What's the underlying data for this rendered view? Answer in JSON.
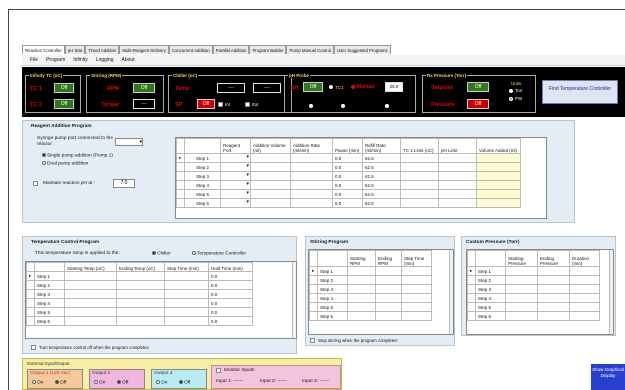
{
  "tabs": [
    "Reaction Controller",
    "pH Stat",
    "Timed Addition",
    "Multi-Reagent Delivery",
    "Concurrent Addition",
    "Parallel Addition",
    "Program Builder",
    "Pump Manual Control",
    "User Suggested Programs"
  ],
  "menu": [
    "File",
    "Program",
    "Infinity",
    "Logging",
    "About"
  ],
  "infinity_tc": {
    "title": "Infinity TC  (oC)",
    "tc1_label": "TC 1",
    "tc2_label": "TC 2",
    "tc1_state": "Off",
    "tc2_state": "Off"
  },
  "stirring": {
    "title": "Stirring (RPM)",
    "rpm_label": "RPM",
    "torque_label": "Torque",
    "rpm_state": "Off",
    "torque_value": "----"
  },
  "chiller": {
    "title": "Chiller (oC)",
    "temp_label": "Temp",
    "sp_label": "SP",
    "temp_value1": "----",
    "temp_value2": "----",
    "sp_state": "Off",
    "int_label": "Int",
    "ext_label": "Ext"
  },
  "ph_probe": {
    "title": "pH Probe",
    "ph_label": "pH",
    "ph_state": "Off",
    "tc1_label": "TC1",
    "manual_label": "Manual",
    "manual_value": "25.0"
  },
  "rx_pressure": {
    "title": "Rx Pressure (Torr)",
    "setpoint_label": "Setpoint",
    "pressure_label": "Pressure",
    "setpoint_state": "Off",
    "pressure_state": "Off",
    "units_label": "Units",
    "torr_label": "Torr",
    "psi_label": "PSI"
  },
  "find_temp_btn": "Find Temperature Controller",
  "reagent": {
    "title": "Reagent Addition Program",
    "syringe_label": "Syringe pump port connected to the reactor :",
    "single_pump": "Single pump addition (Pump 1)",
    "dual_pump": "Dual pump addition",
    "maintain_ph": "Maintain reaction pH at :",
    "ph_value": "7.0",
    "headers": [
      "Reagent Port",
      "Addition Volume (ml)",
      "Addition Rate (ml/min)",
      "Pause (min)",
      "Refill Rate (ml/min)",
      "TC 1 Limit (oC)",
      "pH Limit",
      "Volume Added (ml)"
    ],
    "rows": [
      {
        "step": "Step 1",
        "pause": "0.0",
        "refill": "62.5"
      },
      {
        "step": "Step 2",
        "pause": "0.0",
        "refill": "62.5"
      },
      {
        "step": "Step 3",
        "pause": "0.0",
        "refill": "62.5"
      },
      {
        "step": "Step 4",
        "pause": "0.0",
        "refill": "62.5"
      },
      {
        "step": "Step 5",
        "pause": "0.0",
        "refill": "62.5"
      },
      {
        "step": "Step 6",
        "pause": "0.0",
        "refill": "62.5"
      }
    ]
  },
  "temp_program": {
    "title": "Temperature Control Program",
    "applied_label": "This temperature ramp is applied to the:",
    "chiller_opt": "Chiller",
    "tc_opt": "Temperature Controller",
    "headers": [
      "Starting Temp (oC)",
      "Ending Temp (oC)",
      "Step Time (min)",
      "Hold Time (min)"
    ],
    "rows": [
      {
        "step": "Step 1",
        "hold": "0.0"
      },
      {
        "step": "Step 2",
        "hold": "0.0"
      },
      {
        "step": "Step 3",
        "hold": "0.0"
      },
      {
        "step": "Step 4",
        "hold": "0.0"
      },
      {
        "step": "Step 5",
        "hold": "0.0"
      },
      {
        "step": "Step 6",
        "hold": "0.0"
      }
    ],
    "turn_off": "Turn temperature control off when the program completes"
  },
  "stirring_program": {
    "title": "Stirring Program",
    "headers": [
      "Starting RPM",
      "Ending RPM",
      "Step Time (min)"
    ],
    "rows": [
      "Step 1",
      "Step 2",
      "Step 3",
      "Step 4",
      "Step 5",
      "Step 6"
    ],
    "stop": "Stop stirring when the program completes"
  },
  "pressure_program": {
    "title": "Custom Pressure (Torr)",
    "headers": [
      "Starting Pressure",
      "Ending Pressure",
      "Duration (min)"
    ],
    "rows": [
      "Step 1",
      "Step 2",
      "Step 3",
      "Step 4",
      "Step 5",
      "Step 6"
    ]
  },
  "external_io": {
    "title": "External Input/Output",
    "output1": "Output 1 (120 Vac)",
    "output2": "Output 2",
    "output3": "Output 3",
    "on": "On",
    "off": "Off",
    "monitor": "Monitor Inputs",
    "input1": "Input 1: ------",
    "input2": "Input 2: ------",
    "input3": "Input 3: ------"
  },
  "show_graphical": "Show Graphical Display"
}
